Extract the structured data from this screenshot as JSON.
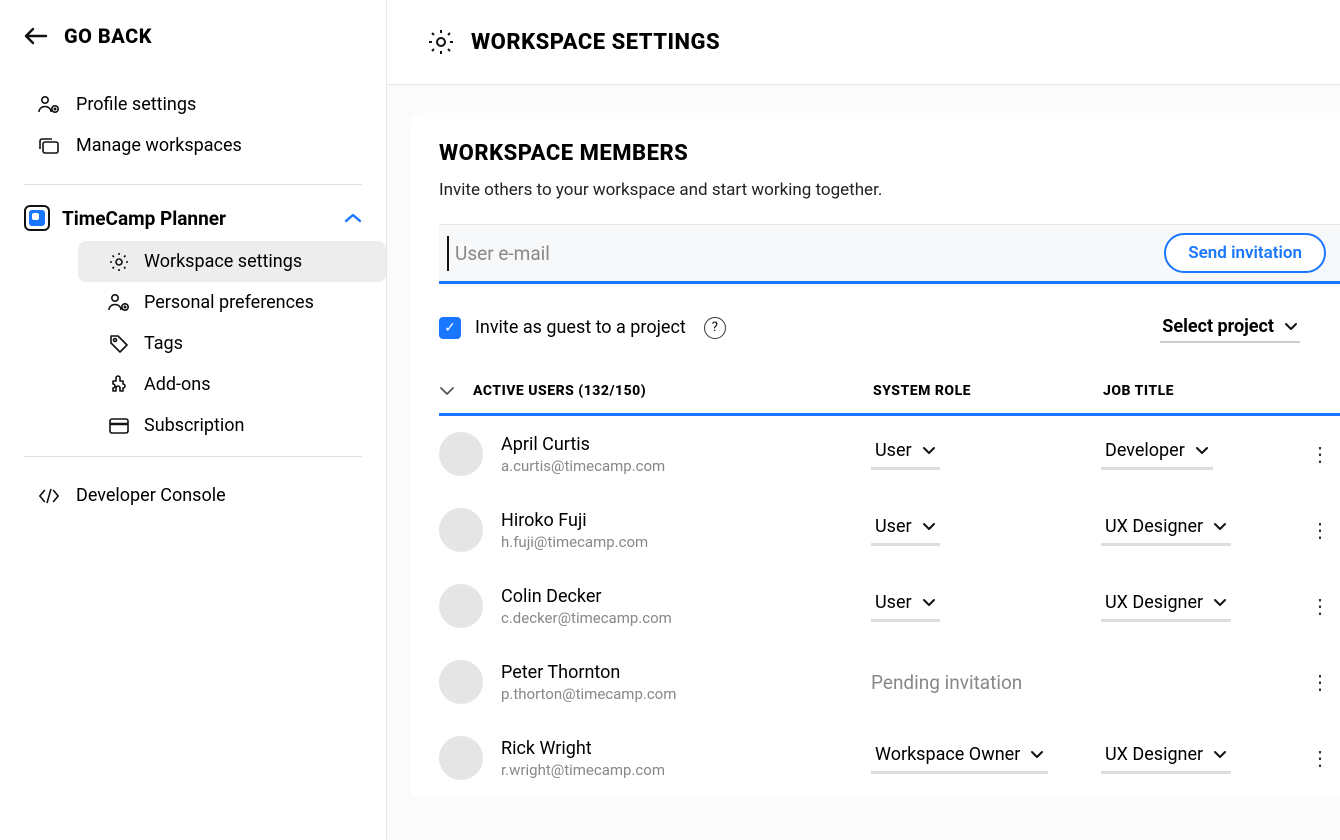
{
  "sidebar": {
    "go_back": "GO BACK",
    "items": {
      "profile": "Profile settings",
      "manage": "Manage workspaces",
      "developer": "Developer Console"
    },
    "workspace": {
      "name": "TimeCamp Planner",
      "sub": {
        "settings": "Workspace settings",
        "prefs": "Personal preferences",
        "tags": "Tags",
        "addons": "Add-ons",
        "subscription": "Subscription"
      }
    }
  },
  "header": {
    "title": "WORKSPACE SETTINGS"
  },
  "members": {
    "title": "WORKSPACE MEMBERS",
    "desc": "Invite others to your workspace and start working together.",
    "email_placeholder": "User e-mail",
    "send": "Send invitation",
    "guest_label": "Invite as guest to a project",
    "project_select": "Select project"
  },
  "table": {
    "active_header": "ACTIVE USERS (132/150)",
    "role_header": "SYSTEM ROLE",
    "job_header": "JOB TITLE",
    "pending_label": "Pending invitation",
    "users": [
      {
        "name": "April Curtis",
        "email": "a.curtis@timecamp.com",
        "role": "User",
        "job": "Developer",
        "pending": false
      },
      {
        "name": "Hiroko Fuji",
        "email": "h.fuji@timecamp.com",
        "role": "User",
        "job": "UX Designer",
        "pending": false
      },
      {
        "name": "Colin Decker",
        "email": "c.decker@timecamp.com",
        "role": "User",
        "job": "UX Designer",
        "pending": false
      },
      {
        "name": "Peter Thornton",
        "email": "p.thorton@timecamp.com",
        "role": "",
        "job": "",
        "pending": true
      },
      {
        "name": "Rick Wright",
        "email": "r.wright@timecamp.com",
        "role": "Workspace Owner",
        "job": "UX Designer",
        "pending": false
      }
    ]
  }
}
